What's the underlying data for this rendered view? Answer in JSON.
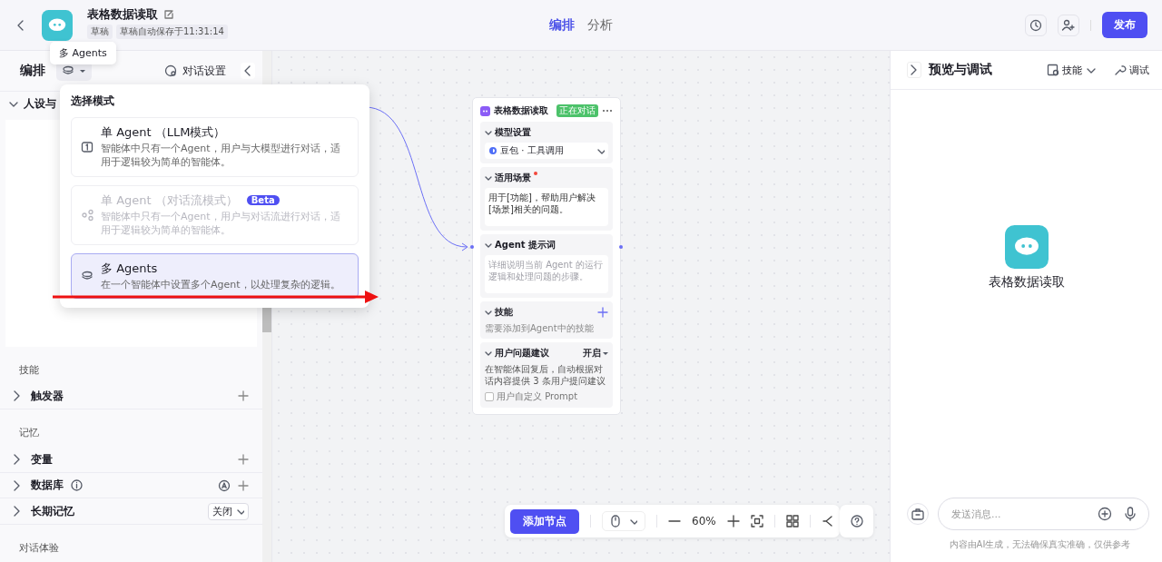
{
  "header": {
    "title": "表格数据读取",
    "badges": [
      "草稿",
      "草稿自动保存于11:31:14"
    ],
    "tabs": [
      {
        "label": "编排",
        "selected": true
      },
      {
        "label": "分析",
        "selected": false
      }
    ],
    "publish": "发布"
  },
  "tooltip": "多 Agents",
  "left_panel": {
    "title": "编排",
    "dialog_settings": "对话设置",
    "persona_section": "人设与",
    "groups": [
      {
        "label": "技能",
        "items": [
          {
            "label": "触发器",
            "kind": "add"
          }
        ]
      },
      {
        "label": "记忆",
        "items": [
          {
            "label": "变量",
            "kind": "add"
          },
          {
            "label": "数据库",
            "kind": "database"
          },
          {
            "label": "长期记忆",
            "kind": "select",
            "value": "关闭"
          }
        ]
      },
      {
        "label": "对话体验"
      }
    ]
  },
  "mode_menu": {
    "title": "选择模式",
    "options": [
      {
        "kind": "single",
        "title": "单 Agent （LLM模式）",
        "description": "智能体中只有一个Agent，用户与大模型进行对话，适用于逻辑较为简单的智能体。",
        "selected": false,
        "disabled": false
      },
      {
        "kind": "flow",
        "title": "单 Agent （对话流模式）",
        "badge": "Beta",
        "description": "智能体中只有一个Agent，用户与对话流进行对话，适用于逻辑较为简单的智能体。",
        "selected": false,
        "disabled": true
      },
      {
        "kind": "multi",
        "title": "多 Agents",
        "description": "在一个智能体中设置多个Agent，以处理复杂的逻辑。",
        "selected": true,
        "disabled": false
      }
    ]
  },
  "node": {
    "title": "表格数据读取",
    "status": "正在对话",
    "sections": [
      {
        "kind": "model",
        "title": "模型设置",
        "value": "豆包 · 工具调用"
      },
      {
        "kind": "text",
        "title": "适用场景",
        "required": true,
        "value": "用于[功能]，帮助用户解决[场景]相关的问题。"
      },
      {
        "kind": "text",
        "title": "Agent 提示词",
        "required": false,
        "placeholder": "详细说明当前 Agent 的运行逻辑和处理问题的步骤。"
      },
      {
        "kind": "skills",
        "title": "技能",
        "hint": "需要添加到Agent中的技能"
      },
      {
        "kind": "suggest",
        "title": "用户问题建议",
        "value": "开启",
        "description": "在智能体回复后，自动根据对话内容提供 3 条用户提问建议",
        "checkbox": {
          "label": "用户自定义 Prompt",
          "checked": false
        }
      }
    ]
  },
  "canvas_toolbar": {
    "add_node": "添加节点",
    "zoom": "60%"
  },
  "preview": {
    "title": "预览与调试",
    "skills": "技能",
    "debug": "调试",
    "bot_name": "表格数据读取",
    "input_placeholder": "发送消息...",
    "footer": "内容由AI生成，无法确保真实准确，仅供参考"
  }
}
